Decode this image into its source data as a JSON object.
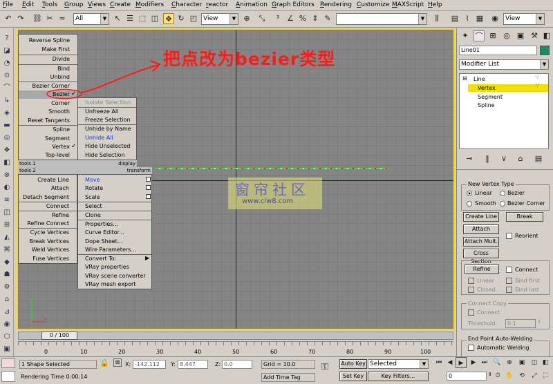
{
  "menu": [
    "File",
    "Edit",
    "Tools",
    "Group",
    "Views",
    "Create",
    "Modifiers",
    "Character",
    "reactor",
    "Animation",
    "Graph Editors",
    "Rendering",
    "Customize",
    "MAXScript",
    "Help"
  ],
  "toolbar": {
    "selection_filter": "All",
    "ref_coord": "View",
    "named_sel": "",
    "viewport_combo": "View"
  },
  "annotation": "把点改为bezier类型",
  "watermark": {
    "cn": "窗帘社区",
    "url": "www.clw8.com"
  },
  "quad": {
    "q1": [
      "Reverse Spline",
      "Make First",
      "Divide",
      "Bind",
      "Unbind",
      "Bezier Corner",
      "Bezier",
      "Corner",
      "Smooth",
      "Reset Tangents",
      "Spline",
      "Segment",
      "Vertex",
      "Top-level"
    ],
    "q1_checks": {
      "bezier": "✓",
      "vertex": "✓"
    },
    "q2": [
      "Isolate Selection",
      "Unfreeze All",
      "Freeze Selection",
      "Unhide by Name",
      "Unhide All",
      "Hide Unselected",
      "Hide Selection"
    ],
    "tools1": "tools 1",
    "display": "display",
    "tools2": "tools 2",
    "transform": "transform",
    "q3": [
      "Create Line",
      "Attach",
      "Detach Segment",
      "Connect",
      "Refine",
      "Refine Connect",
      "Cycle Vertices",
      "Break Vertices",
      "Weld Vertices",
      "Fuse Vertices"
    ],
    "q4": [
      "Move",
      "Rotate",
      "Scale",
      "Select",
      "Clone",
      "Properties...",
      "Curve Editor...",
      "Dope Sheet...",
      "Wire Parameters...",
      "Convert To:",
      "VRay properties",
      "VRay scene converter",
      "VRay mesh export"
    ]
  },
  "panel": {
    "object_name": "Line01",
    "modifier_list": "Modifier List",
    "stack": [
      "Line",
      "Vertex",
      "Segment",
      "Spline"
    ],
    "new_vertex_type": "New Vertex Type",
    "types": [
      "Linear",
      "Bezier",
      "Smooth",
      "Bezier Corner"
    ],
    "buttons": [
      "Create Line",
      "Break",
      "Attach",
      "Attach Mult.",
      "Cross Section",
      "Refine"
    ],
    "reorient": "Reorient",
    "connect": "Connect",
    "linear": "Linear",
    "bind_first": "Bind first",
    "closed": "Closed",
    "bind_last": "Bind last",
    "connect_copy": "Connect Copy",
    "connect2": "Connect",
    "threshold": "Threshold",
    "threshold_val": "0.1",
    "endpoint": "End Point Auto-Welding",
    "auto_weld": "Automatic Welding"
  },
  "timeline": {
    "frame": "0 / 100",
    "ticks": [
      "0",
      "10",
      "20",
      "30",
      "40",
      "50",
      "60",
      "70",
      "80",
      "90",
      "100"
    ]
  },
  "status": {
    "selected": "1 Shape Selected",
    "x_label": "X:",
    "x_val": "-142.112",
    "y_label": "Y:",
    "y_val": "8.447",
    "z_label": "Z:",
    "z_val": "0.0",
    "grid": "Grid = 10.0",
    "auto_key": "Auto Key",
    "key_mode": "Selected",
    "set_key": "Set Key",
    "key_filters": "Key Filters...",
    "frame_field": "0",
    "render_time": "Rendering Time 0:00:14",
    "add_time_tag": "Add Time Tag"
  }
}
